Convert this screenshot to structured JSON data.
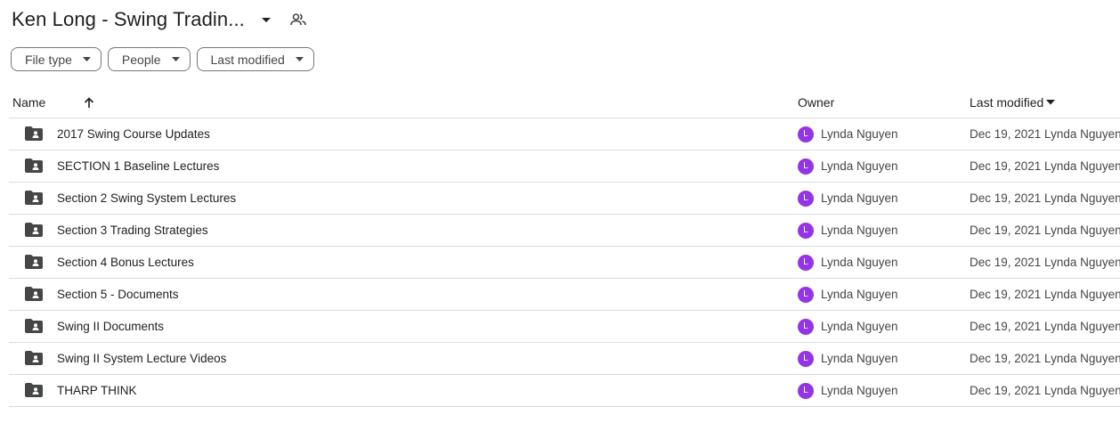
{
  "header": {
    "title": "Ken Long - Swing Tradin...",
    "title_caret_icon": "arrow-drop-down-icon",
    "share_icon": "shared-people-icon"
  },
  "filters": [
    {
      "label": "File type",
      "icon": "arrow-drop-down-icon"
    },
    {
      "label": "People",
      "icon": "arrow-drop-down-icon"
    },
    {
      "label": "Last modified",
      "icon": "arrow-drop-down-icon"
    }
  ],
  "columns": {
    "name": "Name",
    "name_sort_icon": "arrow-upward-icon",
    "owner": "Owner",
    "modified": "Last modified",
    "modified_sort_icon": "arrow-drop-down-icon"
  },
  "colors": {
    "avatar": "#9334e6",
    "folder_icon": "#444746",
    "divider": "#dadce0"
  },
  "rows": [
    {
      "name": "2017 Swing Course Updates",
      "icon": "shared-folder-icon",
      "owner": "Lynda Nguyen",
      "owner_initial": "L",
      "modified": "Dec 19, 2021 Lynda Nguyen"
    },
    {
      "name": "SECTION 1 Baseline Lectures",
      "icon": "shared-folder-icon",
      "owner": "Lynda Nguyen",
      "owner_initial": "L",
      "modified": "Dec 19, 2021 Lynda Nguyen"
    },
    {
      "name": "Section 2 Swing System Lectures",
      "icon": "shared-folder-icon",
      "owner": "Lynda Nguyen",
      "owner_initial": "L",
      "modified": "Dec 19, 2021 Lynda Nguyen"
    },
    {
      "name": "Section 3 Trading Strategies",
      "icon": "shared-folder-icon",
      "owner": "Lynda Nguyen",
      "owner_initial": "L",
      "modified": "Dec 19, 2021 Lynda Nguyen"
    },
    {
      "name": "Section 4 Bonus Lectures",
      "icon": "shared-folder-icon",
      "owner": "Lynda Nguyen",
      "owner_initial": "L",
      "modified": "Dec 19, 2021 Lynda Nguyen"
    },
    {
      "name": "Section 5 - Documents",
      "icon": "shared-folder-icon",
      "owner": "Lynda Nguyen",
      "owner_initial": "L",
      "modified": "Dec 19, 2021 Lynda Nguyen"
    },
    {
      "name": "Swing II Documents",
      "icon": "shared-folder-icon",
      "owner": "Lynda Nguyen",
      "owner_initial": "L",
      "modified": "Dec 19, 2021 Lynda Nguyen"
    },
    {
      "name": "Swing II System Lecture Videos",
      "icon": "shared-folder-icon",
      "owner": "Lynda Nguyen",
      "owner_initial": "L",
      "modified": "Dec 19, 2021 Lynda Nguyen"
    },
    {
      "name": "THARP THINK",
      "icon": "shared-folder-icon",
      "owner": "Lynda Nguyen",
      "owner_initial": "L",
      "modified": "Dec 19, 2021 Lynda Nguyen"
    }
  ]
}
